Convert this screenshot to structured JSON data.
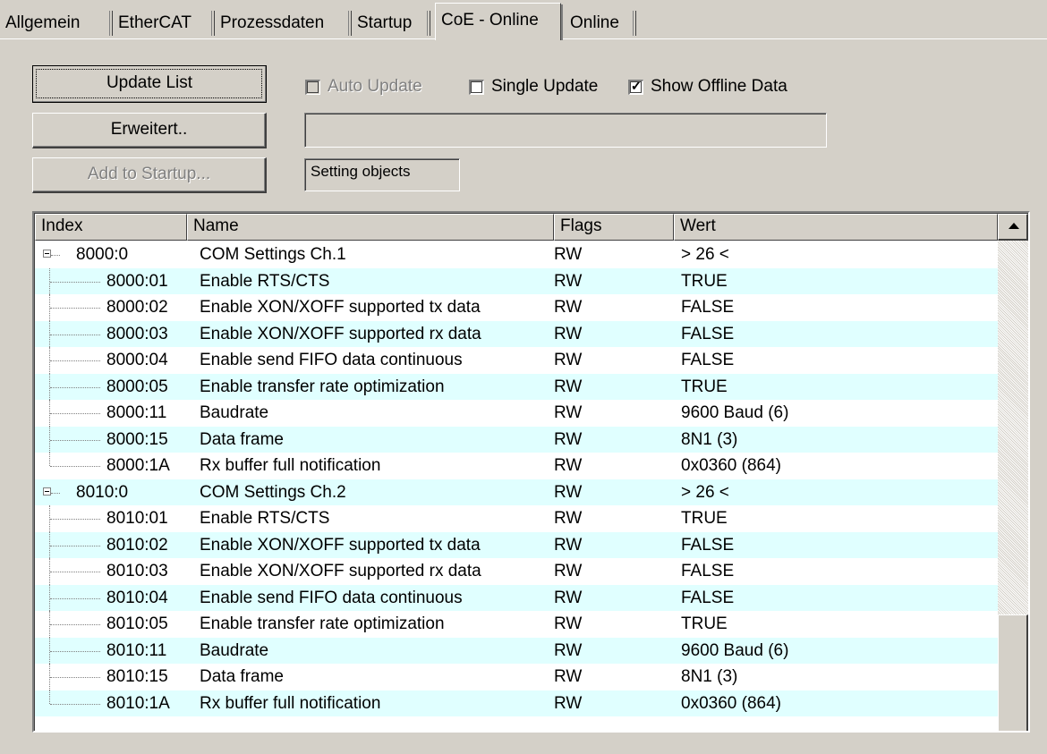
{
  "tabs": [
    {
      "label": "Allgemein",
      "active": false
    },
    {
      "label": "EtherCAT",
      "active": false
    },
    {
      "label": "Prozessdaten",
      "active": false
    },
    {
      "label": "Startup",
      "active": false
    },
    {
      "label": "CoE - Online",
      "active": true
    },
    {
      "label": "Online",
      "active": false
    }
  ],
  "buttons": {
    "update_list": "Update List",
    "erweitert": "Erweitert..",
    "add_to_startup": "Add to Startup..."
  },
  "checkboxes": {
    "auto_update": {
      "label": "Auto Update",
      "checked": false,
      "enabled": false
    },
    "single_update": {
      "label": "Single Update",
      "checked": false,
      "enabled": true
    },
    "show_offline": {
      "label": "Show Offline Data",
      "checked": true,
      "enabled": true
    }
  },
  "status_field": "",
  "setting_objects": "Setting objects",
  "columns": {
    "index": "Index",
    "name": "Name",
    "flags": "Flags",
    "value": "Wert"
  },
  "rows": [
    {
      "index": "8000:0",
      "name": "COM Settings Ch.1",
      "flags": "RW",
      "value": "> 26 <",
      "level": 0
    },
    {
      "index": "8000:01",
      "name": "Enable RTS/CTS",
      "flags": "RW",
      "value": "TRUE",
      "level": 1
    },
    {
      "index": "8000:02",
      "name": "Enable XON/XOFF supported tx data",
      "flags": "RW",
      "value": "FALSE",
      "level": 1
    },
    {
      "index": "8000:03",
      "name": "Enable XON/XOFF supported rx data",
      "flags": "RW",
      "value": "FALSE",
      "level": 1
    },
    {
      "index": "8000:04",
      "name": "Enable send FIFO data continuous",
      "flags": "RW",
      "value": "FALSE",
      "level": 1
    },
    {
      "index": "8000:05",
      "name": "Enable transfer rate optimization",
      "flags": "RW",
      "value": "TRUE",
      "level": 1
    },
    {
      "index": "8000:11",
      "name": "Baudrate",
      "flags": "RW",
      "value": "9600 Baud (6)",
      "level": 1
    },
    {
      "index": "8000:15",
      "name": "Data frame",
      "flags": "RW",
      "value": "8N1 (3)",
      "level": 1
    },
    {
      "index": "8000:1A",
      "name": "Rx buffer full notification",
      "flags": "RW",
      "value": "0x0360 (864)",
      "level": 1
    },
    {
      "index": "8010:0",
      "name": "COM Settings Ch.2",
      "flags": "RW",
      "value": "> 26 <",
      "level": 0
    },
    {
      "index": "8010:01",
      "name": "Enable RTS/CTS",
      "flags": "RW",
      "value": "TRUE",
      "level": 1
    },
    {
      "index": "8010:02",
      "name": "Enable XON/XOFF supported tx data",
      "flags": "RW",
      "value": "FALSE",
      "level": 1
    },
    {
      "index": "8010:03",
      "name": "Enable XON/XOFF supported rx data",
      "flags": "RW",
      "value": "FALSE",
      "level": 1
    },
    {
      "index": "8010:04",
      "name": "Enable send FIFO data continuous",
      "flags": "RW",
      "value": "FALSE",
      "level": 1
    },
    {
      "index": "8010:05",
      "name": "Enable transfer rate optimization",
      "flags": "RW",
      "value": "TRUE",
      "level": 1
    },
    {
      "index": "8010:11",
      "name": "Baudrate",
      "flags": "RW",
      "value": "9600 Baud (6)",
      "level": 1
    },
    {
      "index": "8010:15",
      "name": "Data frame",
      "flags": "RW",
      "value": "8N1 (3)",
      "level": 1
    },
    {
      "index": "8010:1A",
      "name": "Rx buffer full notification",
      "flags": "RW",
      "value": "0x0360 (864)",
      "level": 1
    }
  ],
  "colors": {
    "row_alt": "#e0ffff",
    "window_bg": "#d4d0c8"
  }
}
